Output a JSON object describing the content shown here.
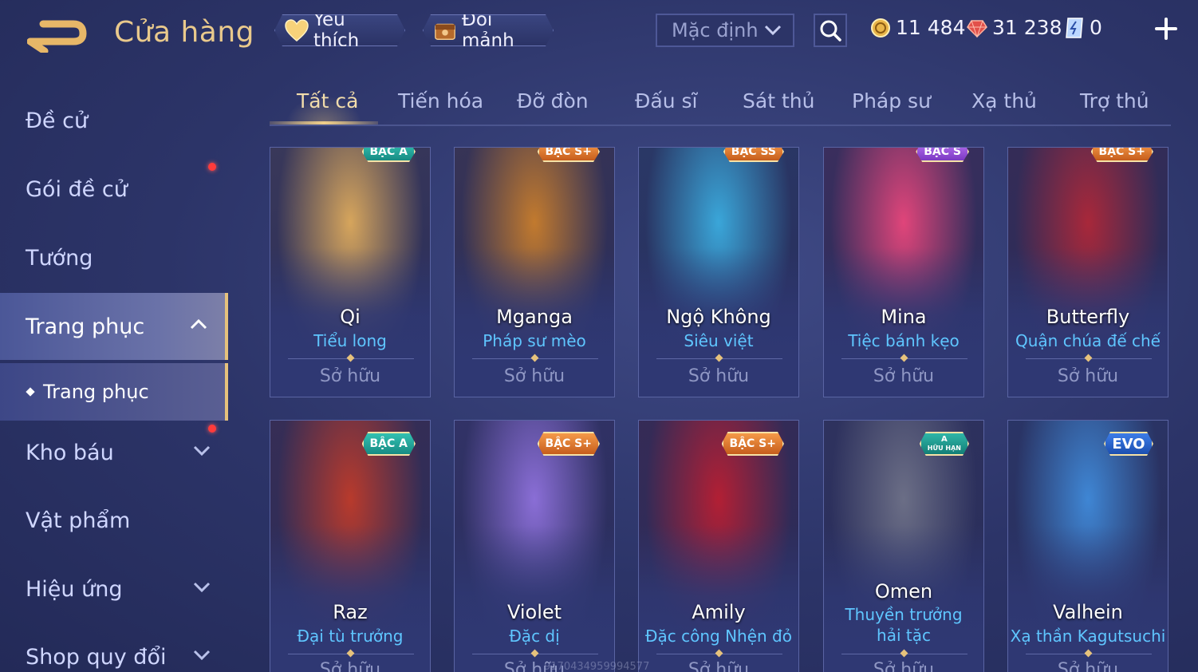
{
  "header": {
    "title": "Cửa hàng",
    "favorites_label": "Yêu thích",
    "exchange_label": "Đổi mảnh",
    "sort_value": "Mặc định",
    "currencies": {
      "gold": "11 484",
      "ruby": "31 238",
      "voucher": "0"
    }
  },
  "sidebar": {
    "items": [
      {
        "label": "Đề cử"
      },
      {
        "label": "Gói đề cử"
      },
      {
        "label": "Tướng"
      },
      {
        "label": "Trang phục"
      },
      {
        "label": "Kho báu"
      },
      {
        "label": "Vật phẩm"
      },
      {
        "label": "Hiệu ứng"
      },
      {
        "label": "Shop quy đổi"
      }
    ],
    "sub_item": "Trang phục"
  },
  "tabs": [
    {
      "label": "Tất cả"
    },
    {
      "label": "Tiến hóa"
    },
    {
      "label": "Đỡ đòn"
    },
    {
      "label": "Đấu sĩ"
    },
    {
      "label": "Sát thủ"
    },
    {
      "label": "Pháp sư"
    },
    {
      "label": "Xạ thủ"
    },
    {
      "label": "Trợ thủ"
    }
  ],
  "cards": [
    {
      "badge": "BẬC A",
      "hero": "Qi",
      "skin": "Tiểu long",
      "status": "Sở hữu",
      "accent": "#d6a55c"
    },
    {
      "badge": "BẬC S+",
      "hero": "Mganga",
      "skin": "Pháp sư mèo",
      "status": "Sở hữu",
      "accent": "#c27a2e"
    },
    {
      "badge": "BẬC SS",
      "hero": "Ngộ Không",
      "skin": "Siêu việt",
      "status": "Sở hữu",
      "accent": "#3aa6d9"
    },
    {
      "badge": "BẬC S",
      "hero": "Mina",
      "skin": "Tiệc bánh kẹo",
      "status": "Sở hữu",
      "accent": "#e0457a"
    },
    {
      "badge": "BẬC S+",
      "hero": "Butterfly",
      "skin": "Quận chúa đế chế",
      "status": "Sở hữu",
      "accent": "#a8283a"
    },
    {
      "badge": "BẬC A",
      "hero": "Raz",
      "skin": "Đại tù trưởng",
      "status": "Sở hữu",
      "accent": "#b83a2c"
    },
    {
      "badge": "BẬC S+",
      "hero": "Violet",
      "skin": "Đặc dị",
      "status": "Sở hữu",
      "accent": "#8a6ed6"
    },
    {
      "badge": "BẬC S+",
      "hero": "Amily",
      "skin": "Đặc công Nhện đỏ",
      "status": "Sở hữu",
      "accent": "#b21f34"
    },
    {
      "badge_line1": "A",
      "badge_line2": "HỮU HẠN",
      "hero": "Omen",
      "skin": "Thuyền trưởng hải tặc",
      "status": "Sở hữu",
      "accent": "#6b6e86"
    },
    {
      "badge": "EVO",
      "hero": "Valhein",
      "skin": "Xạ thần Kagutsuchi",
      "status": "Sở hữu",
      "accent": "#3f86d4"
    }
  ],
  "watermark": "9170434959994577"
}
